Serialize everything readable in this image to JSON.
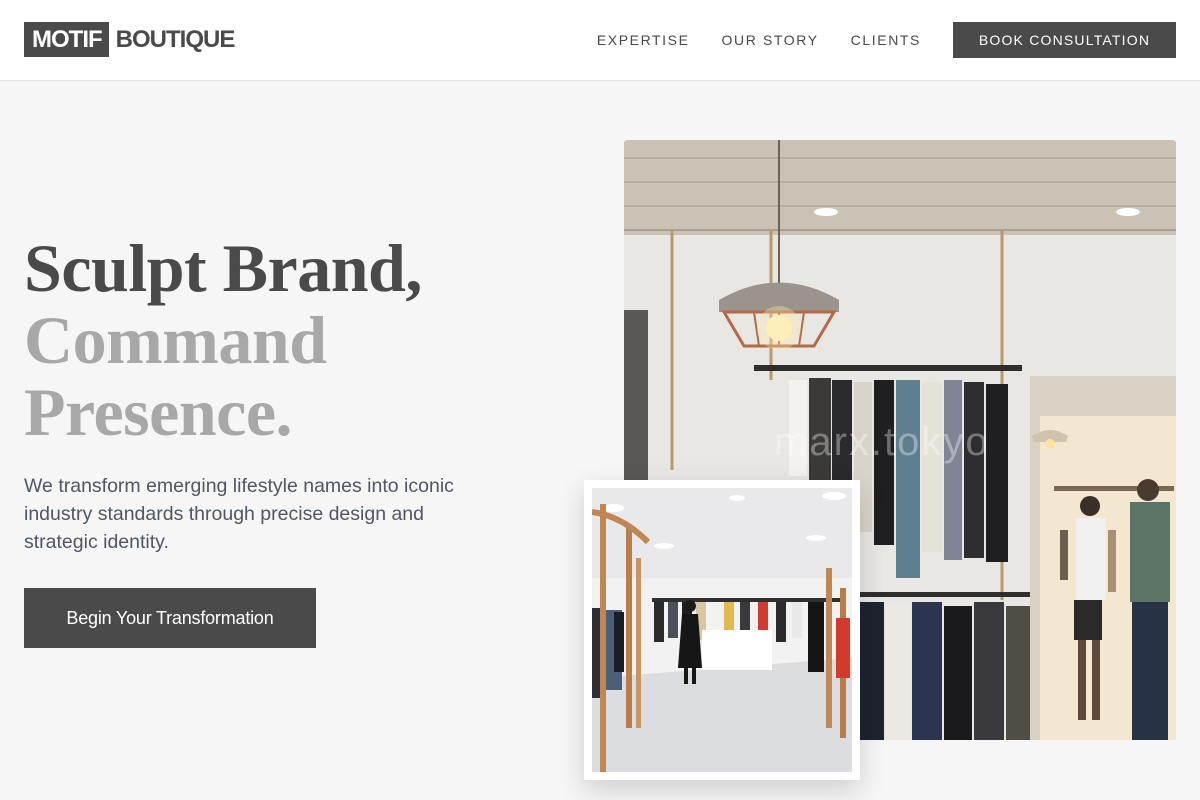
{
  "brand": {
    "mark": "MOTIF",
    "name": "BOUTIQUE"
  },
  "nav": {
    "items": [
      {
        "label": "EXPERTISE"
      },
      {
        "label": "OUR STORY"
      },
      {
        "label": "CLIENTS"
      }
    ],
    "cta_label": "BOOK CONSULTATION"
  },
  "hero": {
    "headline_line1": "Sculpt Brand,",
    "headline_line2": "Command",
    "headline_line3": "Presence.",
    "subtext": "We transform emerging lifestyle names into iconic industry standards through precise design and strategic identity.",
    "cta_label": "Begin Your Transformation"
  },
  "images": {
    "main_watermark": "marx.tokyo"
  },
  "colors": {
    "primary": "#4a4a4a",
    "muted_headline": "#a8a8a8",
    "background": "#f6f6f6",
    "header_bg": "#ffffff"
  }
}
